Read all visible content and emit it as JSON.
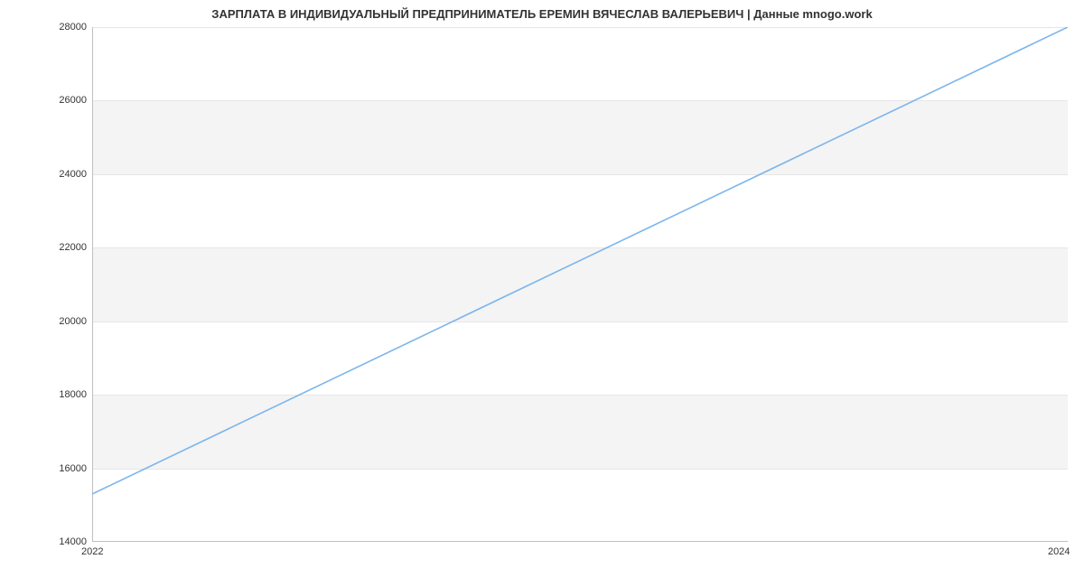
{
  "chart_data": {
    "type": "line",
    "title": "ЗАРПЛАТА В ИНДИВИДУАЛЬНЫЙ ПРЕДПРИНИМАТЕЛЬ ЕРЕМИН ВЯЧЕСЛАВ ВАЛЕРЬЕВИЧ | Данные mnogo.work",
    "xlabel": "",
    "ylabel": "",
    "x": [
      2022,
      2024
    ],
    "values": [
      15300,
      28000
    ],
    "y_ticks": [
      14000,
      16000,
      18000,
      20000,
      22000,
      24000,
      26000,
      28000
    ],
    "x_ticks": [
      2022,
      2024
    ],
    "ylim": [
      14000,
      28000
    ],
    "xlim": [
      2022,
      2024
    ],
    "line_color": "#7cb5ec",
    "grid_band_color": "#f4f4f4"
  },
  "y_tick_labels": {
    "0": "14000",
    "1": "16000",
    "2": "18000",
    "3": "20000",
    "4": "22000",
    "5": "24000",
    "6": "26000",
    "7": "28000"
  },
  "x_tick_labels": {
    "0": "2022",
    "1": "2024"
  }
}
